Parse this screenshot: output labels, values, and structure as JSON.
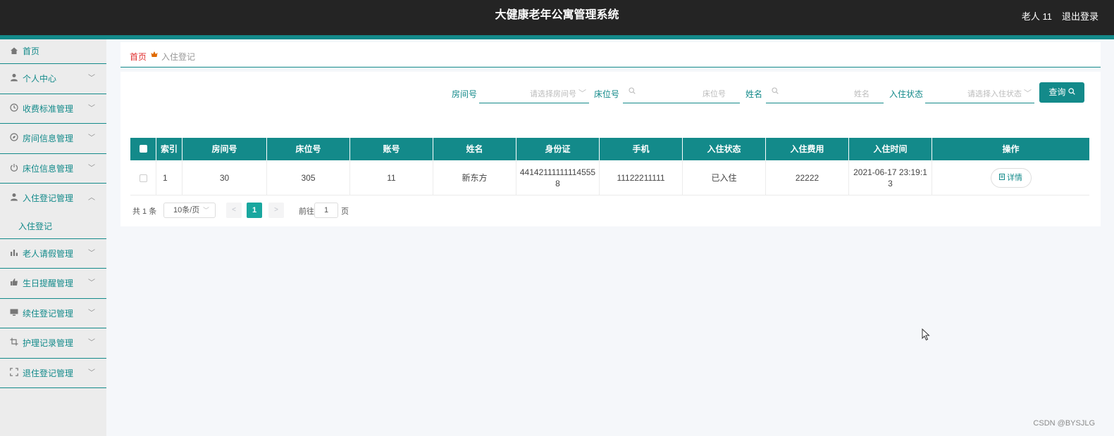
{
  "header": {
    "title": "大健康老年公寓管理系统",
    "user": "老人 11",
    "logout": "退出登录"
  },
  "sidebar": {
    "items": [
      {
        "label": "首页",
        "icon": "home-icon"
      },
      {
        "label": "个人中心",
        "icon": "user-icon"
      },
      {
        "label": "收费标准管理",
        "icon": "clock-icon"
      },
      {
        "label": "房间信息管理",
        "icon": "compass-icon"
      },
      {
        "label": "床位信息管理",
        "icon": "power-icon"
      },
      {
        "label": "入住登记管理",
        "icon": "user-icon"
      },
      {
        "label": "老人请假管理",
        "icon": "bar-chart-icon"
      },
      {
        "label": "生日提醒管理",
        "icon": "thumbs-up-icon"
      },
      {
        "label": "续住登记管理",
        "icon": "monitor-icon"
      },
      {
        "label": "护理记录管理",
        "icon": "crop-icon"
      },
      {
        "label": "退住登记管理",
        "icon": "fullscreen-icon"
      }
    ],
    "submenu": {
      "label": "入住登记"
    }
  },
  "breadcrumb": {
    "home": "首页",
    "current": "入住登记"
  },
  "filters": {
    "room_label": "房间号",
    "room_placeholder": "请选择房间号",
    "bed_label": "床位号",
    "bed_placeholder": "床位号",
    "name_label": "姓名",
    "name_placeholder": "姓名",
    "status_label": "入住状态",
    "status_placeholder": "请选择入住状态",
    "search_button": "查询"
  },
  "table": {
    "columns": [
      "索引",
      "房间号",
      "床位号",
      "账号",
      "姓名",
      "身份证",
      "手机",
      "入住状态",
      "入住费用",
      "入住时间",
      "操作"
    ],
    "rows": [
      {
        "index": "1",
        "room": "30",
        "bed": "305",
        "account": "11",
        "name": "新东方",
        "id_card": "441421111111145558",
        "phone": "11122211111",
        "status": "已入住",
        "fee": "22222",
        "time": "2021-06-17 23:19:13",
        "action": "详情"
      }
    ]
  },
  "pagination": {
    "total": "共 1 条",
    "page_size": "10条/页",
    "current_page": "1",
    "goto_prefix": "前往",
    "goto_value": "1",
    "goto_suffix": "页"
  },
  "watermark": "CSDN @BYSJLG",
  "colors": {
    "accent": "#138a8a",
    "topbar": "#242424",
    "breadcrumb_home": "#e03030",
    "page_active": "#19a79f"
  }
}
